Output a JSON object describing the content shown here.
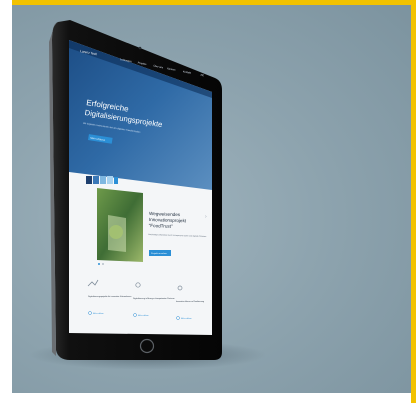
{
  "scene": {
    "accent_color": "#f2c200",
    "background_color": "#8ea4af"
  },
  "website": {
    "logo_text": "Lorenz Tech",
    "nav_items": [
      "Leistungen",
      "Projekte",
      "Über uns",
      "Karriere",
      "Kontakt"
    ],
    "lang": "DE",
    "hero": {
      "headline_line1": "Erfolgreiche",
      "headline_line2": "Digitalisierungsprojekte",
      "subtext": "Wir begleiten Unternehmen bei der digitalen Transformation",
      "cta": "Mehr erfahren"
    },
    "feature": {
      "title_line1": "Wegweisendes",
      "title_line2": "Innovationsprojekt",
      "title_line3": "\"FoodTrust\"",
      "body": "Nachhaltige Lieferketten durch transparente Daten und digitale Prozesse",
      "cta": "Projekt ansehen"
    },
    "cards": [
      {
        "icon": "chart-icon",
        "title": "Digitalisierungsprojekte für innovative Unternehmen",
        "link": "Mehr erfahren"
      },
      {
        "icon": "people-icon",
        "title": "Digitalisierung in Bezug zu kompetenten Partnern",
        "link": "Mehr erfahren"
      },
      {
        "icon": "bulb-icon",
        "title": "Innovative Ideen zur Realisierung",
        "link": "Mehr erfahren"
      }
    ]
  }
}
